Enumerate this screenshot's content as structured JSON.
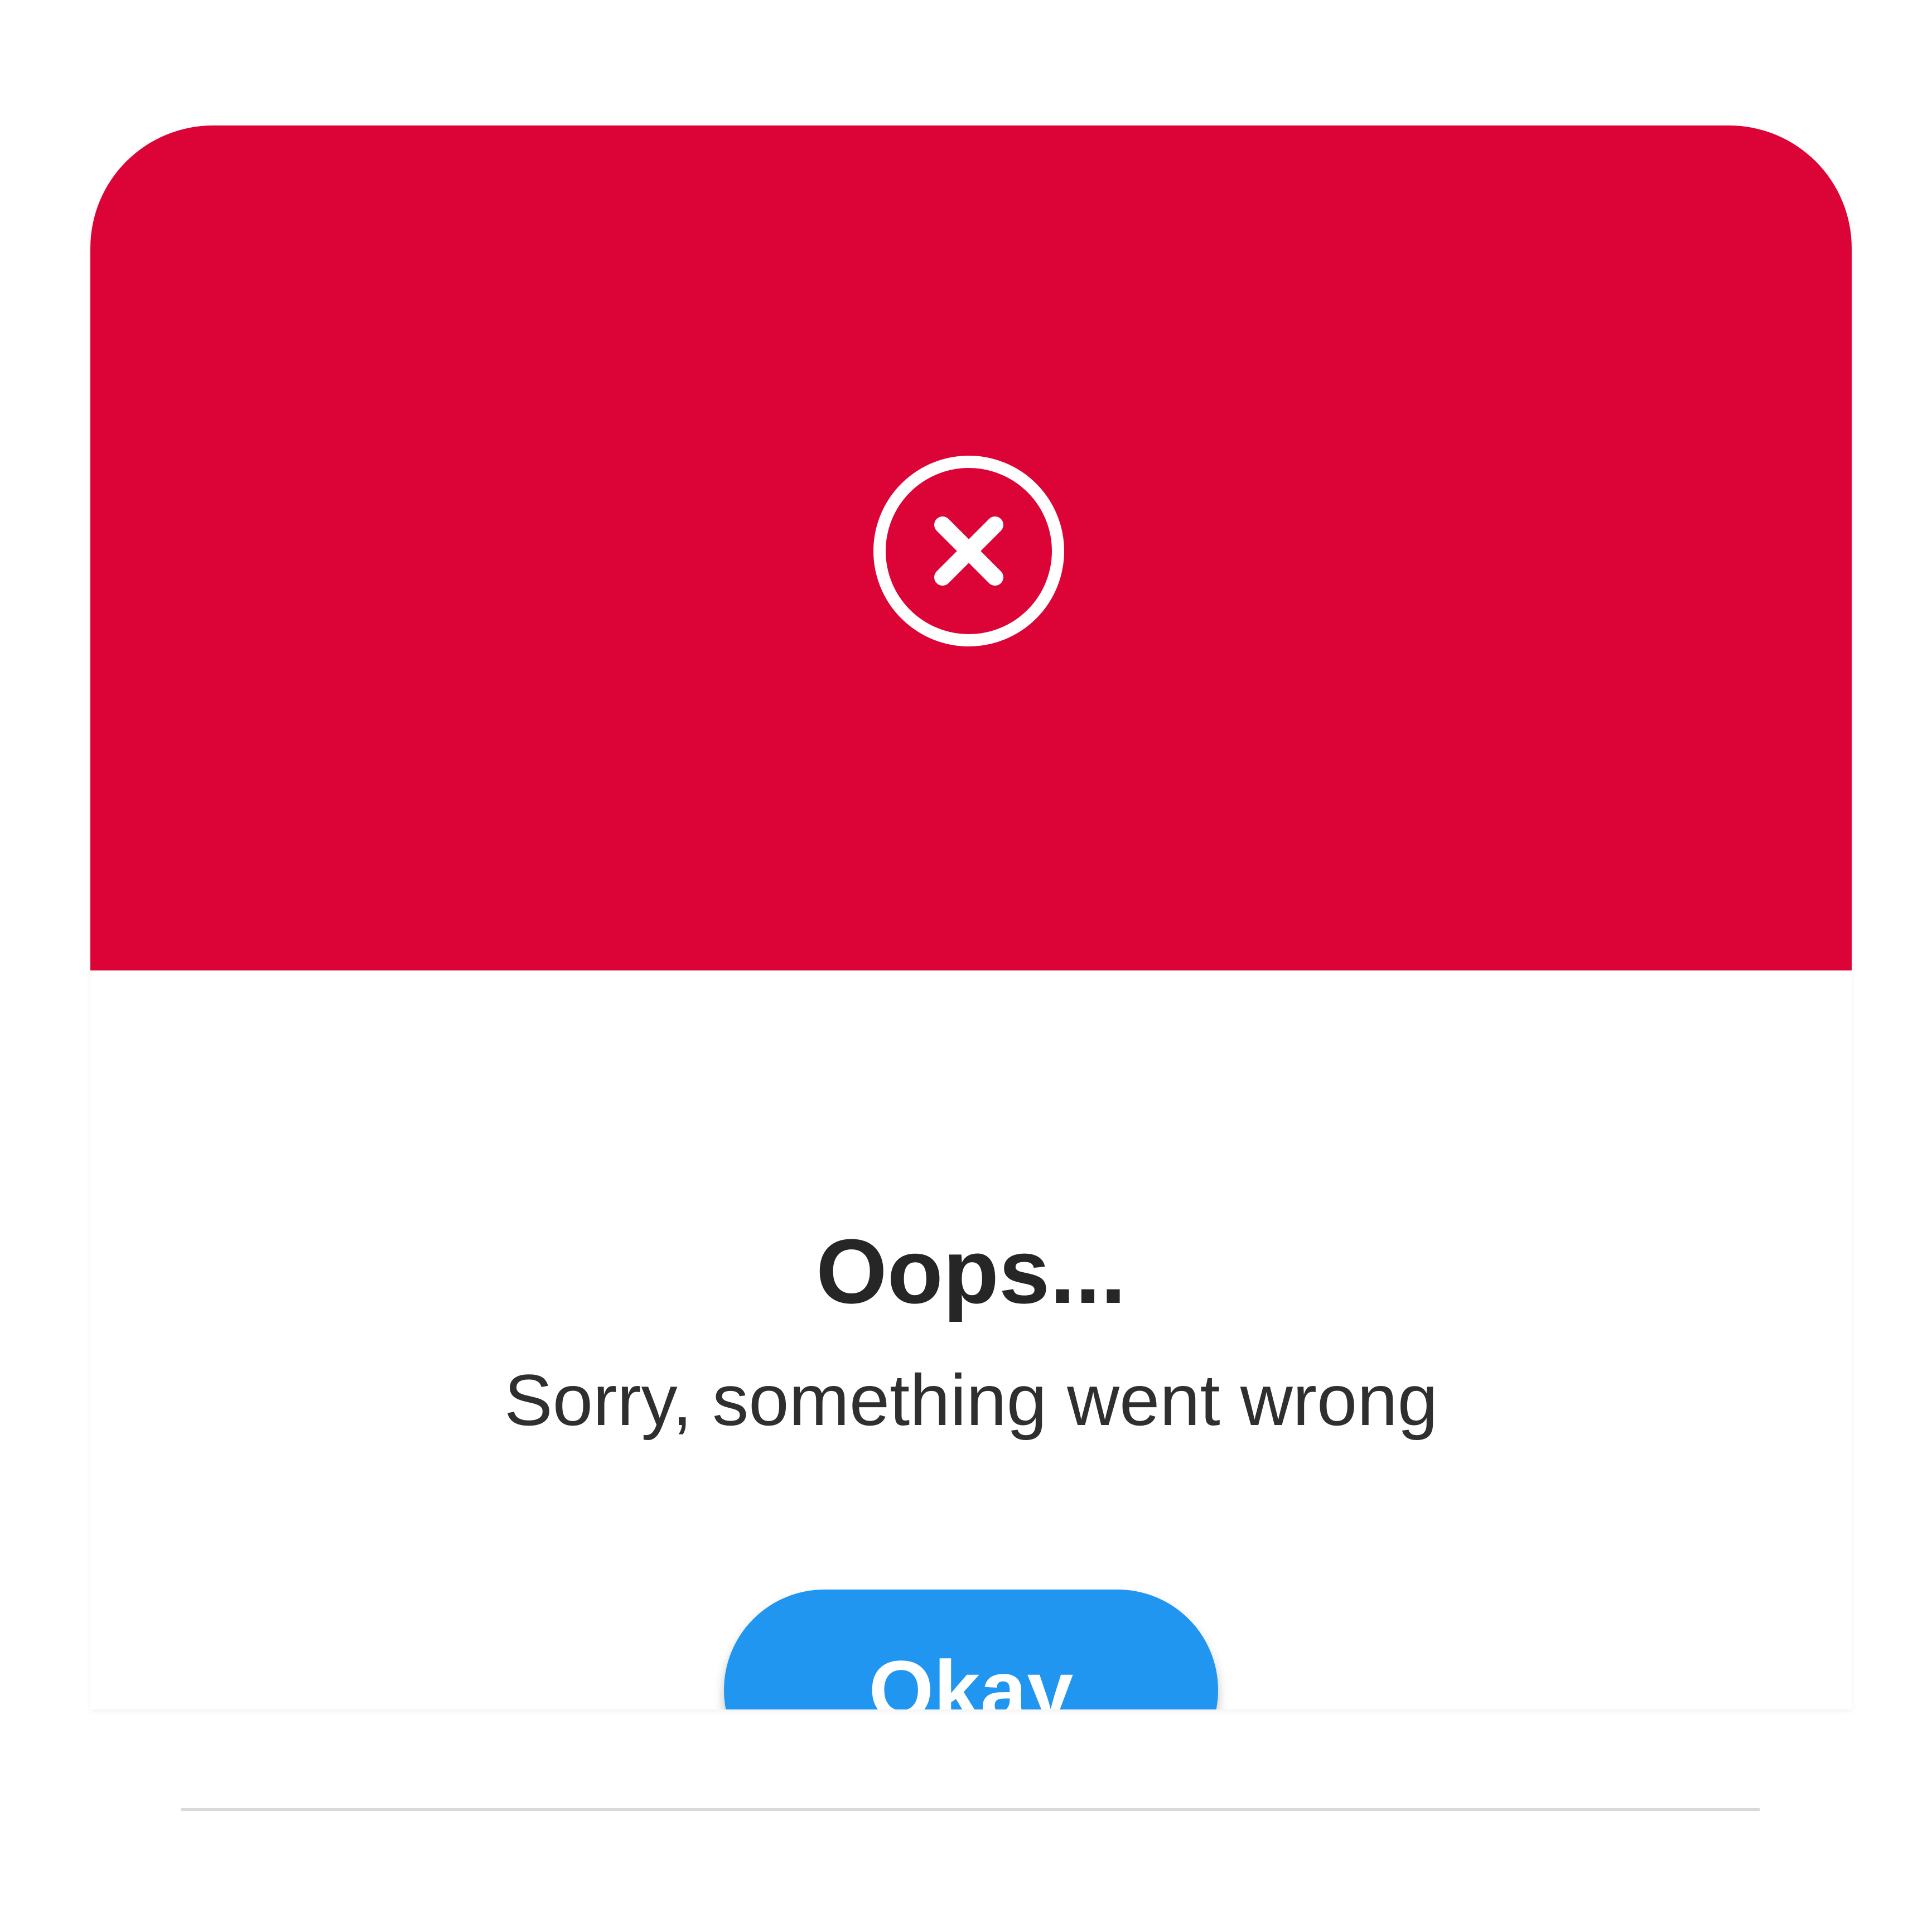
{
  "dialog": {
    "title": "Oops...",
    "message": "Sorry, something went wrong",
    "okay_label": "Okay",
    "icon": "circle-x-icon"
  },
  "colors": {
    "header_background": "#dc0336",
    "button_background": "#2196f0",
    "title_text": "#262626",
    "button_text": "#ffffff"
  }
}
